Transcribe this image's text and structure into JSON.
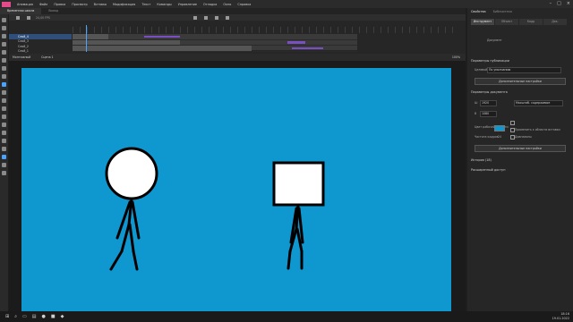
{
  "app": {
    "menu": [
      "Анимация",
      "Файл",
      "Правка",
      "Просмотр",
      "Вставка",
      "Модификация",
      "Текст",
      "Команды",
      "Управление",
      "Отладка",
      "Окно",
      "Справка"
    ]
  },
  "tabs": [
    "Временная шкала",
    "Вывод"
  ],
  "timeline": {
    "fps_label": "24,00 FPS",
    "layers": [
      "Слой_4",
      "Слой_3",
      "Слой_2",
      "Слой_1"
    ]
  },
  "scene": {
    "label": "Монтажный",
    "scene_name": "Сцена 1",
    "zoom": "100%"
  },
  "properties": {
    "tabs": [
      "Свойства",
      "Библиотека"
    ],
    "segments": [
      "Инструмент",
      "Объект",
      "Кадр",
      "Док."
    ],
    "doc_label": "Документ",
    "params_title": "Параметры публикации",
    "target_label": "Целевой",
    "target_value": "По умолчанию",
    "more_settings": "Дополнительные настройки",
    "doc_params_title": "Параметры документа",
    "width_label": "Ш",
    "width_value": "1920",
    "height_label": "В",
    "height_value": "1080",
    "scale_label": "Масштаб. содержимое",
    "fps_label": "Частота кадров",
    "fps_value": "24",
    "stage_color_label": "Цвет рабочей области",
    "apply_label": "Применить к области вставки",
    "guides_label": "Диапазоны",
    "doc_settings": "Дополнительные настройки",
    "history_title": "История (18)",
    "access_title": "Расширенный доступ"
  },
  "colors": {
    "stage": "#0e98cf",
    "accent": "#4aa3ff",
    "keyframe": "#7a4fc4"
  },
  "taskbar": {
    "time": "18:16",
    "date": "19.01.2022"
  }
}
